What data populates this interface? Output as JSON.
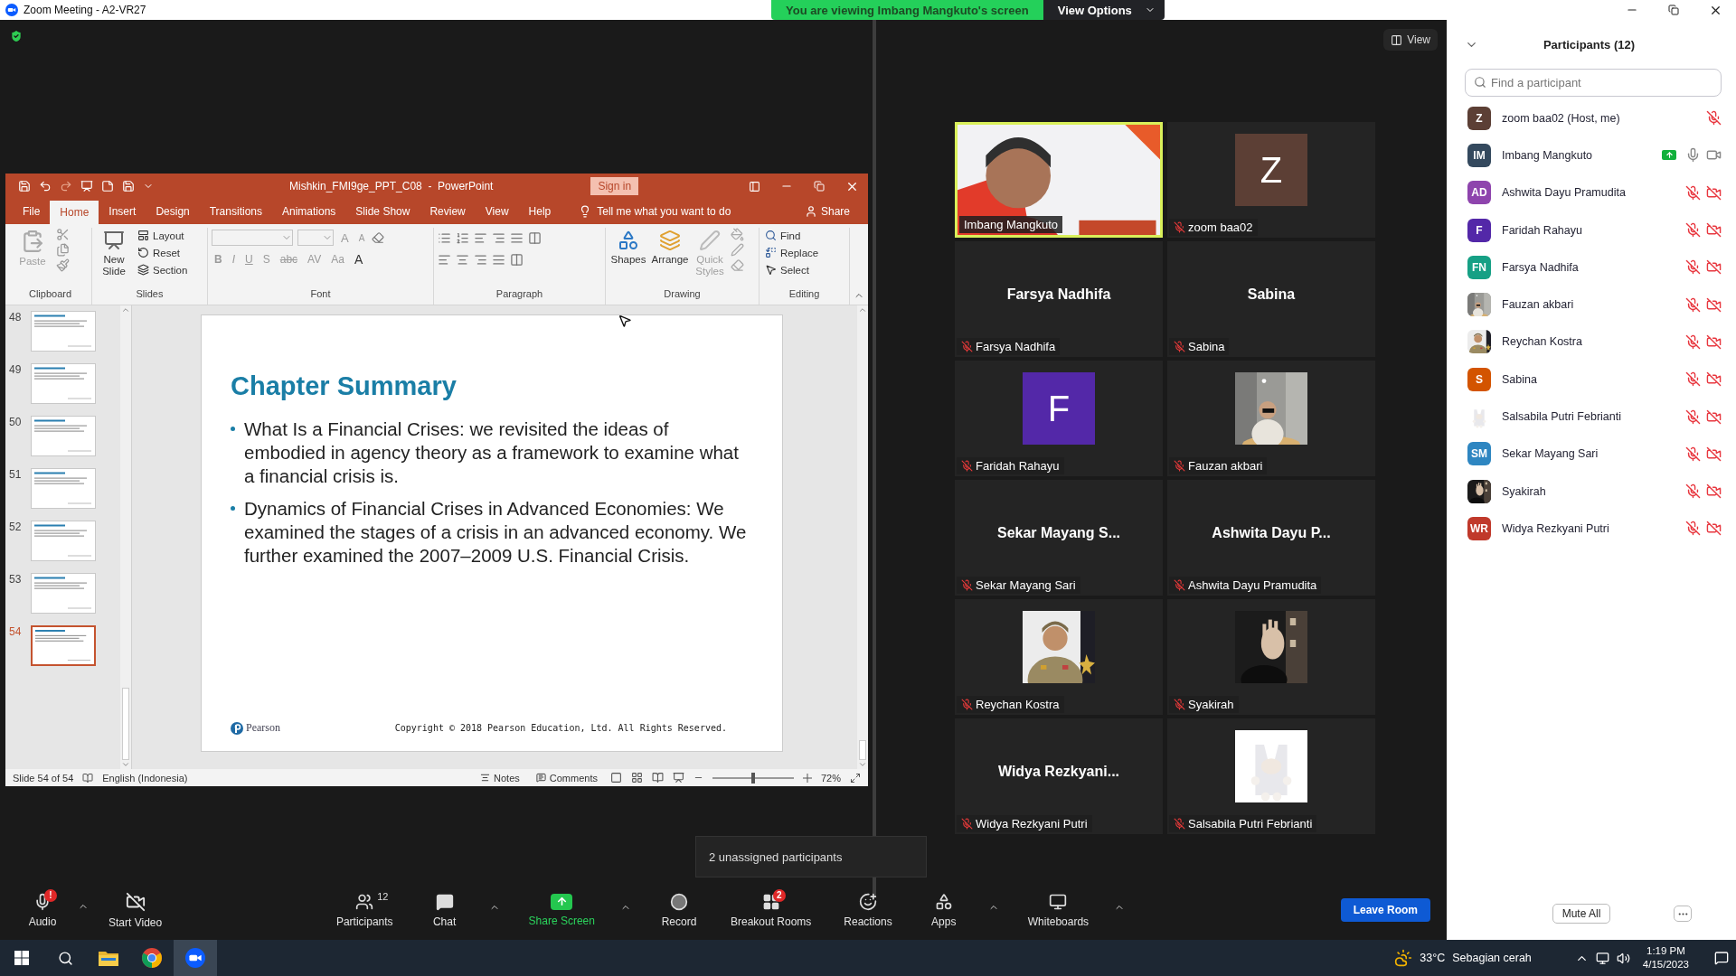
{
  "window": {
    "title": "Zoom Meeting - A2-VR27"
  },
  "share_banner": {
    "text": "You are viewing Imbang Mangkuto's screen",
    "options": "View Options"
  },
  "view_button": "View",
  "powerpoint": {
    "title": "Mishkin_FMI9ge_PPT_C08  -  PowerPoint",
    "sign_in": "Sign in",
    "tabs": [
      {
        "label": "File",
        "selected": false
      },
      {
        "label": "Home",
        "selected": true
      },
      {
        "label": "Insert",
        "selected": false
      },
      {
        "label": "Design",
        "selected": false
      },
      {
        "label": "Transitions",
        "selected": false
      },
      {
        "label": "Animations",
        "selected": false
      },
      {
        "label": "Slide Show",
        "selected": false
      },
      {
        "label": "Review",
        "selected": false
      },
      {
        "label": "View",
        "selected": false
      },
      {
        "label": "Help",
        "selected": false
      }
    ],
    "tell_me": "Tell me what you want to do",
    "share": "Share",
    "ribbon_groups": [
      {
        "kind": "clipboard",
        "label": "Clipboard",
        "items": [
          {
            "label": "Paste",
            "disabled": true
          }
        ]
      },
      {
        "kind": "slides",
        "label": "Slides",
        "items": [
          {
            "label": "New Slide",
            "disabled": false
          },
          {
            "label": "Layout",
            "disabled": false
          },
          {
            "label": "Reset",
            "disabled": false
          },
          {
            "label": "Section",
            "disabled": false
          }
        ]
      },
      {
        "kind": "font",
        "label": "Font",
        "items": [
          {
            "label": "A",
            "disabled": true
          },
          {
            "label": "A",
            "disabled": true
          },
          {
            "label": "B",
            "disabled": true
          },
          {
            "label": "I",
            "disabled": true
          },
          {
            "label": "U",
            "disabled": true
          },
          {
            "label": "S",
            "disabled": true
          },
          {
            "label": "abc",
            "disabled": true
          },
          {
            "label": "AV",
            "disabled": true
          },
          {
            "label": "Aa",
            "disabled": true
          },
          {
            "label": "A",
            "disabled": false
          }
        ]
      },
      {
        "kind": "paragraph",
        "label": "Paragraph"
      },
      {
        "kind": "drawing",
        "label": "Drawing",
        "items": [
          {
            "label": "Shapes",
            "disabled": false
          },
          {
            "label": "Arrange",
            "disabled": false
          },
          {
            "label": "Quick Styles",
            "disabled": true
          }
        ]
      },
      {
        "kind": "editing",
        "label": "Editing",
        "items": [
          {
            "label": "Find",
            "disabled": false
          },
          {
            "label": "Replace",
            "disabled": false
          },
          {
            "label": "Select",
            "disabled": false
          }
        ]
      }
    ],
    "thumbnails": [
      {
        "number": "48",
        "selected": false
      },
      {
        "number": "49",
        "selected": false
      },
      {
        "number": "50",
        "selected": false
      },
      {
        "number": "51",
        "selected": false
      },
      {
        "number": "52",
        "selected": false
      },
      {
        "number": "53",
        "selected": false
      },
      {
        "number": "54",
        "selected": true
      }
    ],
    "slide": {
      "title": "Chapter Summary",
      "bullets": [
        "What Is a Financial Crises: we revisited the ideas of embodied in agency theory as a framework to examine what a financial crisis is.",
        "Dynamics of Financial Crises in Advanced Economies: We examined the stages of a crisis in an advanced economy. We further examined the 2007–2009 U.S. Financial Crisis."
      ],
      "logo": "Pearson",
      "copyright": "Copyright © 2018 Pearson Education, Ltd. All Rights Reserved."
    },
    "status_bar": {
      "slide_count": "Slide 54 of 54",
      "language": "English (Indonesia)",
      "notes": "Notes",
      "comments": "Comments",
      "zoom": "72%",
      "zoom_slider": {
        "level": 0.5
      }
    }
  },
  "gallery": [
    {
      "name": "Imbang Mangkuto",
      "kind": "video",
      "active": true,
      "muted": false
    },
    {
      "name": "zoom baa02",
      "kind": "letter",
      "letter": "Z",
      "color": "#5c3f35",
      "active": false,
      "muted": true
    },
    {
      "name": "Farsya Nadhifa",
      "kind": "name",
      "display": "Farsya Nadhifa",
      "active": false,
      "muted": true
    },
    {
      "name": "Sabina",
      "kind": "name",
      "display": "Sabina",
      "active": false,
      "muted": true
    },
    {
      "name": "Faridah Rahayu",
      "kind": "letter",
      "letter": "F",
      "color": "#5328a8",
      "active": false,
      "muted": true
    },
    {
      "name": "Fauzan akbari",
      "active": false,
      "muted": true
    },
    {
      "name": "Sekar Mayang Sari",
      "kind": "name",
      "display": "Sekar Mayang S...",
      "active": false,
      "muted": true
    },
    {
      "name": "Ashwita Dayu Pramudita",
      "kind": "name",
      "display": "Ashwita Dayu P...",
      "active": false,
      "muted": true
    },
    {
      "name": "Reychan Kostra",
      "active": false,
      "muted": true
    },
    {
      "name": "Syakirah",
      "active": false,
      "muted": true
    },
    {
      "name": "Widya Rezkyani Putri",
      "kind": "name",
      "display": "Widya Rezkyani...",
      "active": false,
      "muted": true
    },
    {
      "name": "Salsabila Putri Febrianti",
      "active": false,
      "muted": true
    }
  ],
  "toolbar": [
    {
      "kind": "audio",
      "label": "Audio",
      "badge": "!",
      "caret": true
    },
    {
      "kind": "video",
      "label": "Start Video",
      "caret": false
    },
    {
      "kind": "participants",
      "label": "Participants",
      "count": "12",
      "caret": false
    },
    {
      "kind": "chat",
      "label": "Chat",
      "caret": true
    },
    {
      "kind": "share",
      "label": "Share Screen",
      "caret": true
    },
    {
      "kind": "record",
      "label": "Record",
      "caret": false
    },
    {
      "kind": "breakout",
      "label": "Breakout Rooms",
      "badge": "2",
      "caret": false
    },
    {
      "kind": "reactions",
      "label": "Reactions",
      "caret": false
    },
    {
      "kind": "apps",
      "label": "Apps",
      "caret": true
    },
    {
      "kind": "whiteboards",
      "label": "Whiteboards",
      "caret": true
    }
  ],
  "leave_button": "Leave Room",
  "tooltip": "2 unassigned participants",
  "panel": {
    "title": "Participants (12)",
    "search_placeholder": "Find a participant",
    "mute_all": "Mute All",
    "participants": [
      {
        "name": "zoom baa02 (Host, me)",
        "kind": "initials",
        "initials": "Z",
        "color": "#5c3f35",
        "muted": true,
        "camera_icon": false,
        "sharing": false
      },
      {
        "name": "Imbang Mangkuto",
        "kind": "initials",
        "initials": "IM",
        "color": "#34495e",
        "muted": false,
        "camera_icon": true,
        "video_off": false,
        "sharing": true
      },
      {
        "name": "Ashwita Dayu Pramudita",
        "kind": "initials",
        "initials": "AD",
        "color": "#8e44ad",
        "muted": true,
        "camera_icon": true,
        "video_off": true,
        "sharing": false
      },
      {
        "name": "Faridah Rahayu",
        "kind": "initials",
        "initials": "F",
        "color": "#5328a8",
        "muted": true,
        "camera_icon": true,
        "video_off": true,
        "sharing": false
      },
      {
        "name": "Farsya Nadhifa",
        "kind": "initials",
        "initials": "FN",
        "color": "#16a085",
        "muted": true,
        "camera_icon": true,
        "video_off": true,
        "sharing": false
      },
      {
        "name": "Fauzan akbari",
        "muted": true,
        "camera_icon": true,
        "video_off": true,
        "sharing": false
      },
      {
        "name": "Reychan Kostra",
        "muted": true,
        "camera_icon": true,
        "video_off": true,
        "sharing": false
      },
      {
        "name": "Sabina",
        "kind": "initials",
        "initials": "S",
        "color": "#d35400",
        "muted": true,
        "camera_icon": true,
        "video_off": true,
        "sharing": false
      },
      {
        "name": "Salsabila Putri Febrianti",
        "muted": true,
        "camera_icon": true,
        "video_off": true,
        "sharing": false
      },
      {
        "name": "Sekar Mayang Sari",
        "kind": "initials",
        "initials": "SM",
        "color": "#2e86c1",
        "muted": true,
        "camera_icon": true,
        "video_off": true,
        "sharing": false
      },
      {
        "name": "Syakirah",
        "muted": true,
        "camera_icon": true,
        "video_off": true,
        "sharing": false
      },
      {
        "name": "Widya Rezkyani Putri",
        "kind": "initials",
        "initials": "WR",
        "color": "#c0392b",
        "muted": true,
        "camera_icon": true,
        "video_off": true,
        "sharing": false
      }
    ]
  },
  "taskbar": {
    "temperature": "33°C",
    "weather": "Sebagian cerah",
    "time": "1:19 PM",
    "date": "4/15/2023",
    "apps": [
      {
        "kind": "explorer",
        "active": false
      },
      {
        "kind": "chrome",
        "active": false
      },
      {
        "kind": "zoom",
        "active": true
      }
    ]
  }
}
